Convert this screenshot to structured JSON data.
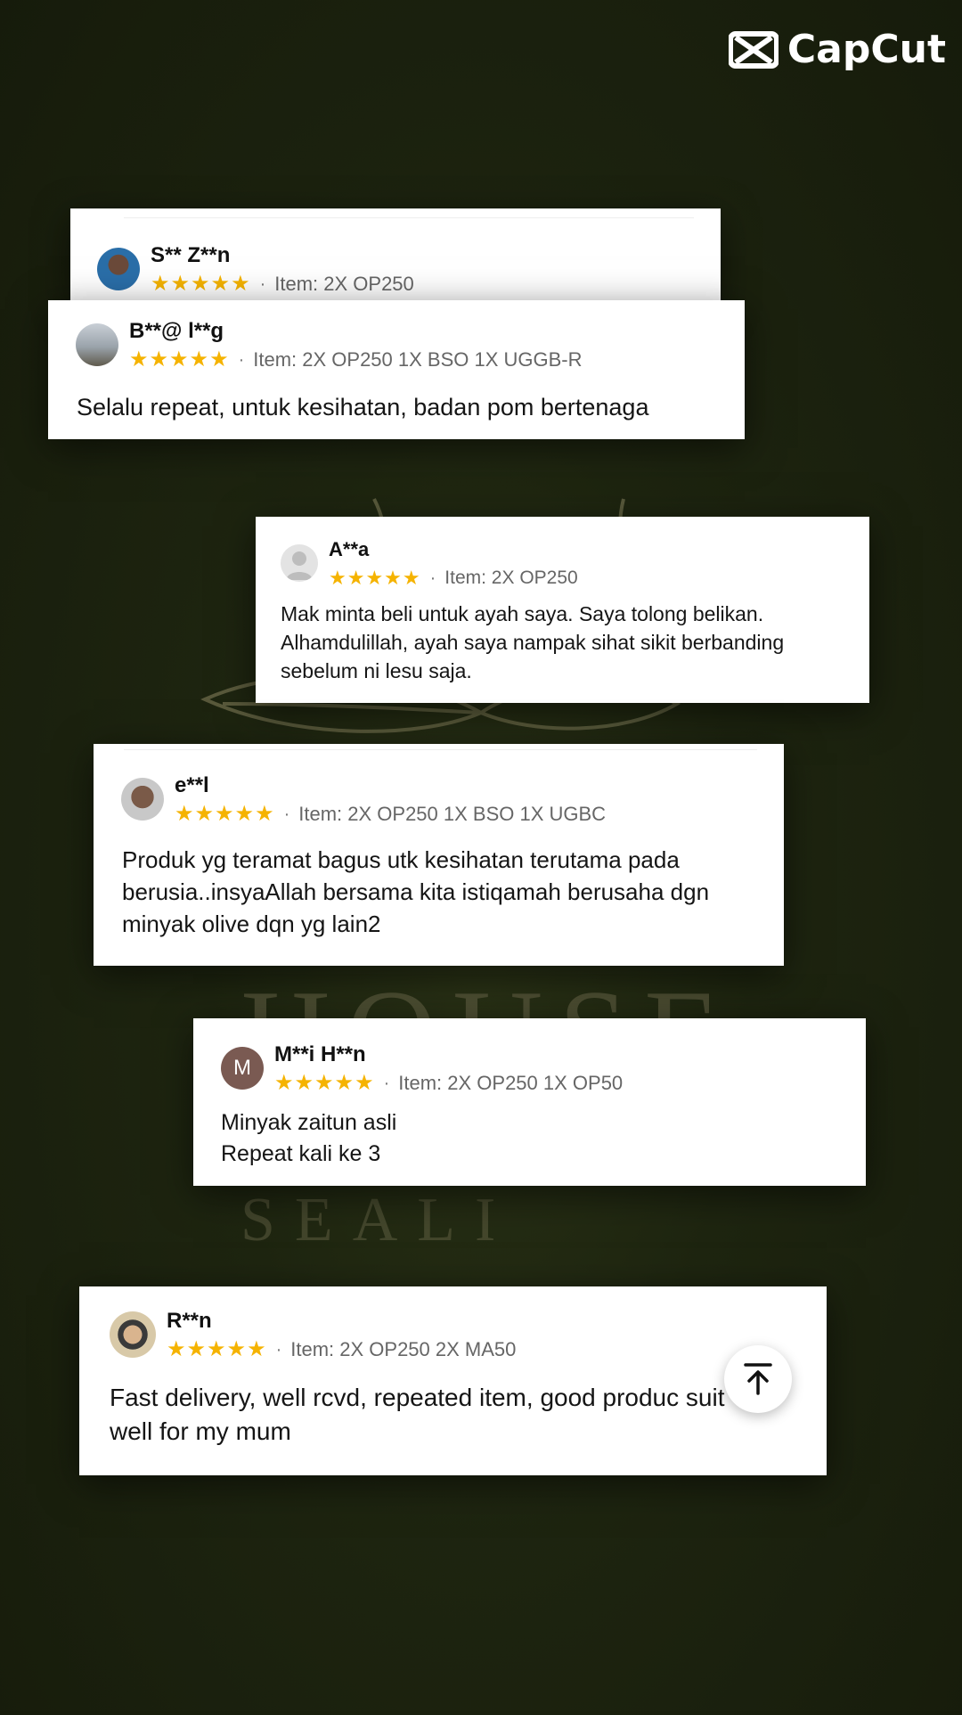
{
  "brand": {
    "name": "CapCut"
  },
  "background": {
    "word1": "HOUSE",
    "word2": "BAGHA SEALI"
  },
  "reviews": [
    {
      "name": "S** Z**n",
      "stars": "★★★★★",
      "item": "Item: 2X OP250",
      "text": ""
    },
    {
      "name": "B**@ l**g",
      "stars": "★★★★★",
      "item": "Item: 2X OP250 1X BSO 1X UGGB-R",
      "text": "Selalu repeat, untuk kesihatan, badan pom bertenaga"
    },
    {
      "name": "A**a",
      "stars": "★★★★★",
      "item": "Item: 2X OP250",
      "text": "Mak minta beli untuk ayah saya. Saya tolong belikan. Alhamdulillah, ayah saya nampak sihat sikit berbanding sebelum ni lesu saja."
    },
    {
      "name": "e**l",
      "stars": "★★★★★",
      "item": "Item: 2X OP250 1X BSO 1X UGBC",
      "text": "Produk yg teramat bagus utk kesihatan terutama pada berusia..insyaAllah bersama kita istiqamah berusaha dgn minyak olive dqn yg lain2"
    },
    {
      "name": "M**i H**n",
      "stars": "★★★★★",
      "item": "Item: 2X OP250 1X OP50",
      "text_line1": "Minyak zaitun asli",
      "text_line2": "Repeat kali ke 3",
      "avatar_letter": "M"
    },
    {
      "name": "R**n",
      "stars": "★★★★★",
      "item": "Item: 2X OP250 2X MA50",
      "text": "Fast delivery, well rcvd, repeated item, good produc suit well for my mum"
    }
  ],
  "dot": "·",
  "icons": {
    "scroll_top": "arrow-up-to-line-icon",
    "brand_logo": "capcut-logo-icon"
  },
  "colors": {
    "star": "#f5b301",
    "background": "#1e2510"
  }
}
